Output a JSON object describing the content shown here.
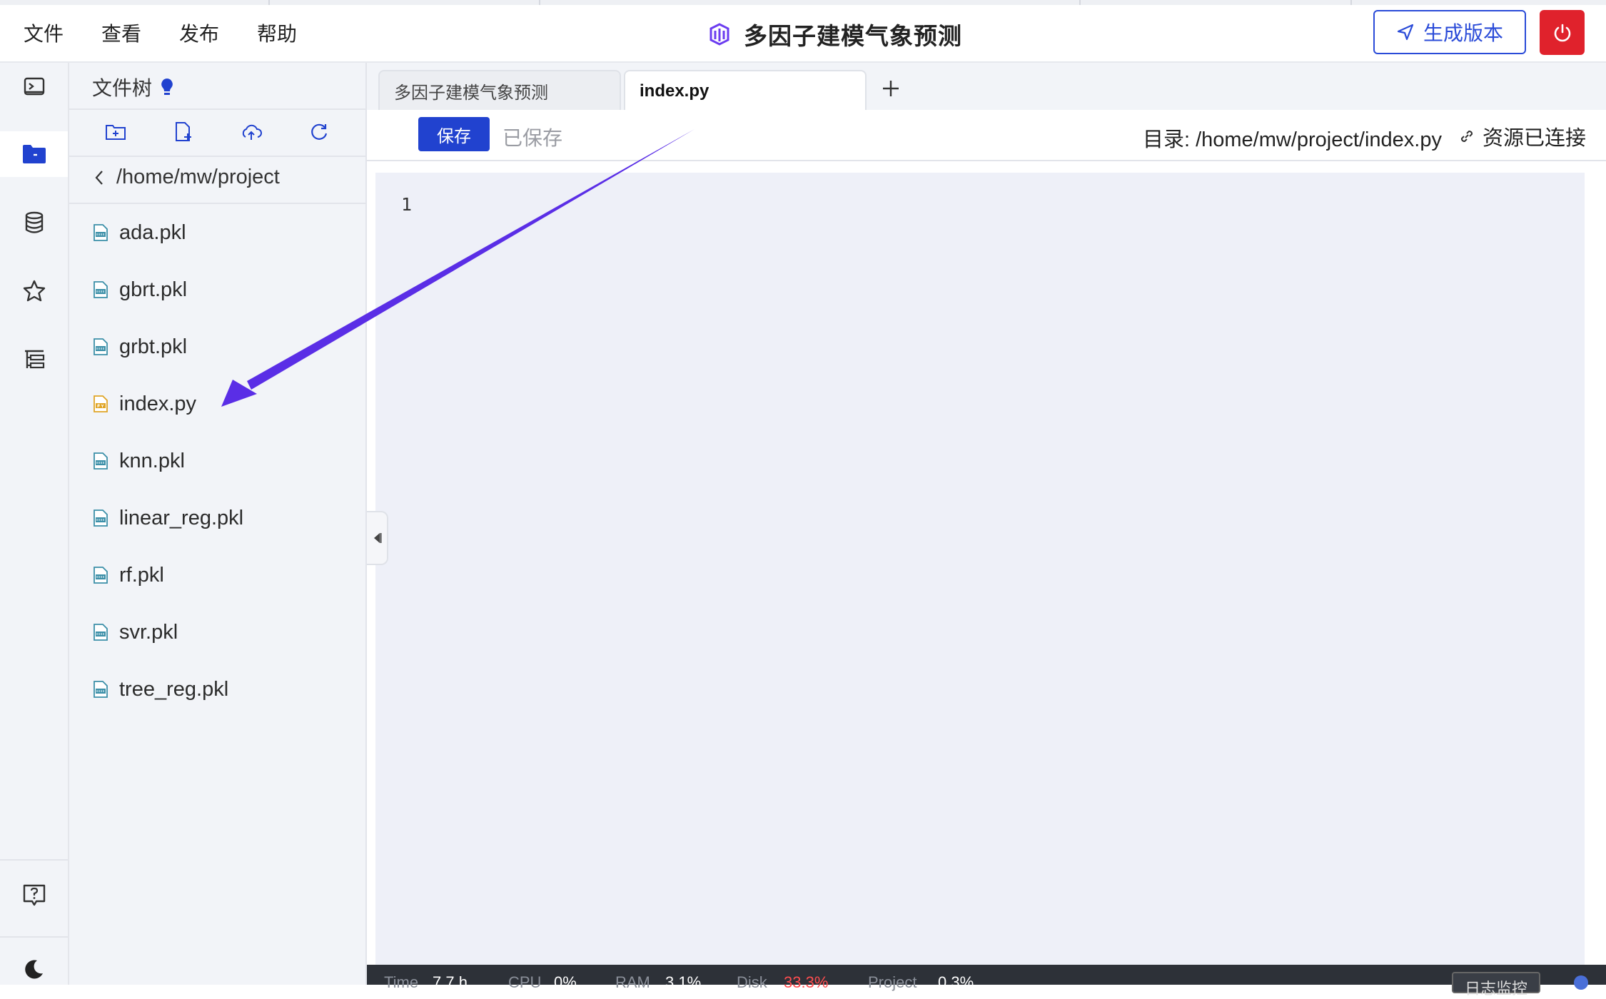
{
  "menu": [
    "文件",
    "查看",
    "发布",
    "帮助"
  ],
  "header": {
    "title": "多因子建模气象预测",
    "generate_label": "生成版本"
  },
  "rail": {
    "icons": [
      "terminal-icon",
      "folder-icon",
      "database-icon",
      "star-icon",
      "tree-list-icon",
      "help-icon",
      "moon-icon"
    ],
    "active": "folder-icon"
  },
  "tree": {
    "title": "文件树",
    "path": "/home/mw/project",
    "files": [
      {
        "name": "ada.pkl",
        "type": "pkl"
      },
      {
        "name": "gbrt.pkl",
        "type": "pkl"
      },
      {
        "name": "grbt.pkl",
        "type": "pkl"
      },
      {
        "name": "index.py",
        "type": "py"
      },
      {
        "name": "knn.pkl",
        "type": "pkl"
      },
      {
        "name": "linear_reg.pkl",
        "type": "pkl"
      },
      {
        "name": "rf.pkl",
        "type": "pkl"
      },
      {
        "name": "svr.pkl",
        "type": "pkl"
      },
      {
        "name": "tree_reg.pkl",
        "type": "pkl"
      }
    ]
  },
  "tabs": [
    {
      "label": "多因子建模气象预测",
      "active": false
    },
    {
      "label": "index.py",
      "active": true
    }
  ],
  "toolbar": {
    "save_label": "保存",
    "saved_label": "已保存",
    "dir_label": "目录:  /home/mw/project/index.py",
    "connection_label": "资源已连接"
  },
  "editor": {
    "line_numbers": [
      "1"
    ]
  },
  "status": {
    "items": [
      {
        "label": "Time",
        "value": "7.7 h"
      },
      {
        "label": "CPU",
        "value": "0%"
      },
      {
        "label": "RAM",
        "value": "3.1%"
      },
      {
        "label": "Disk",
        "value": "33.3%"
      },
      {
        "label": "Project",
        "value": "0.3%"
      }
    ],
    "log_label": "日志监控"
  },
  "colors": {
    "accent": "#2142cf",
    "danger": "#e0222c",
    "annotation_arrow": "#5a2ee6"
  }
}
